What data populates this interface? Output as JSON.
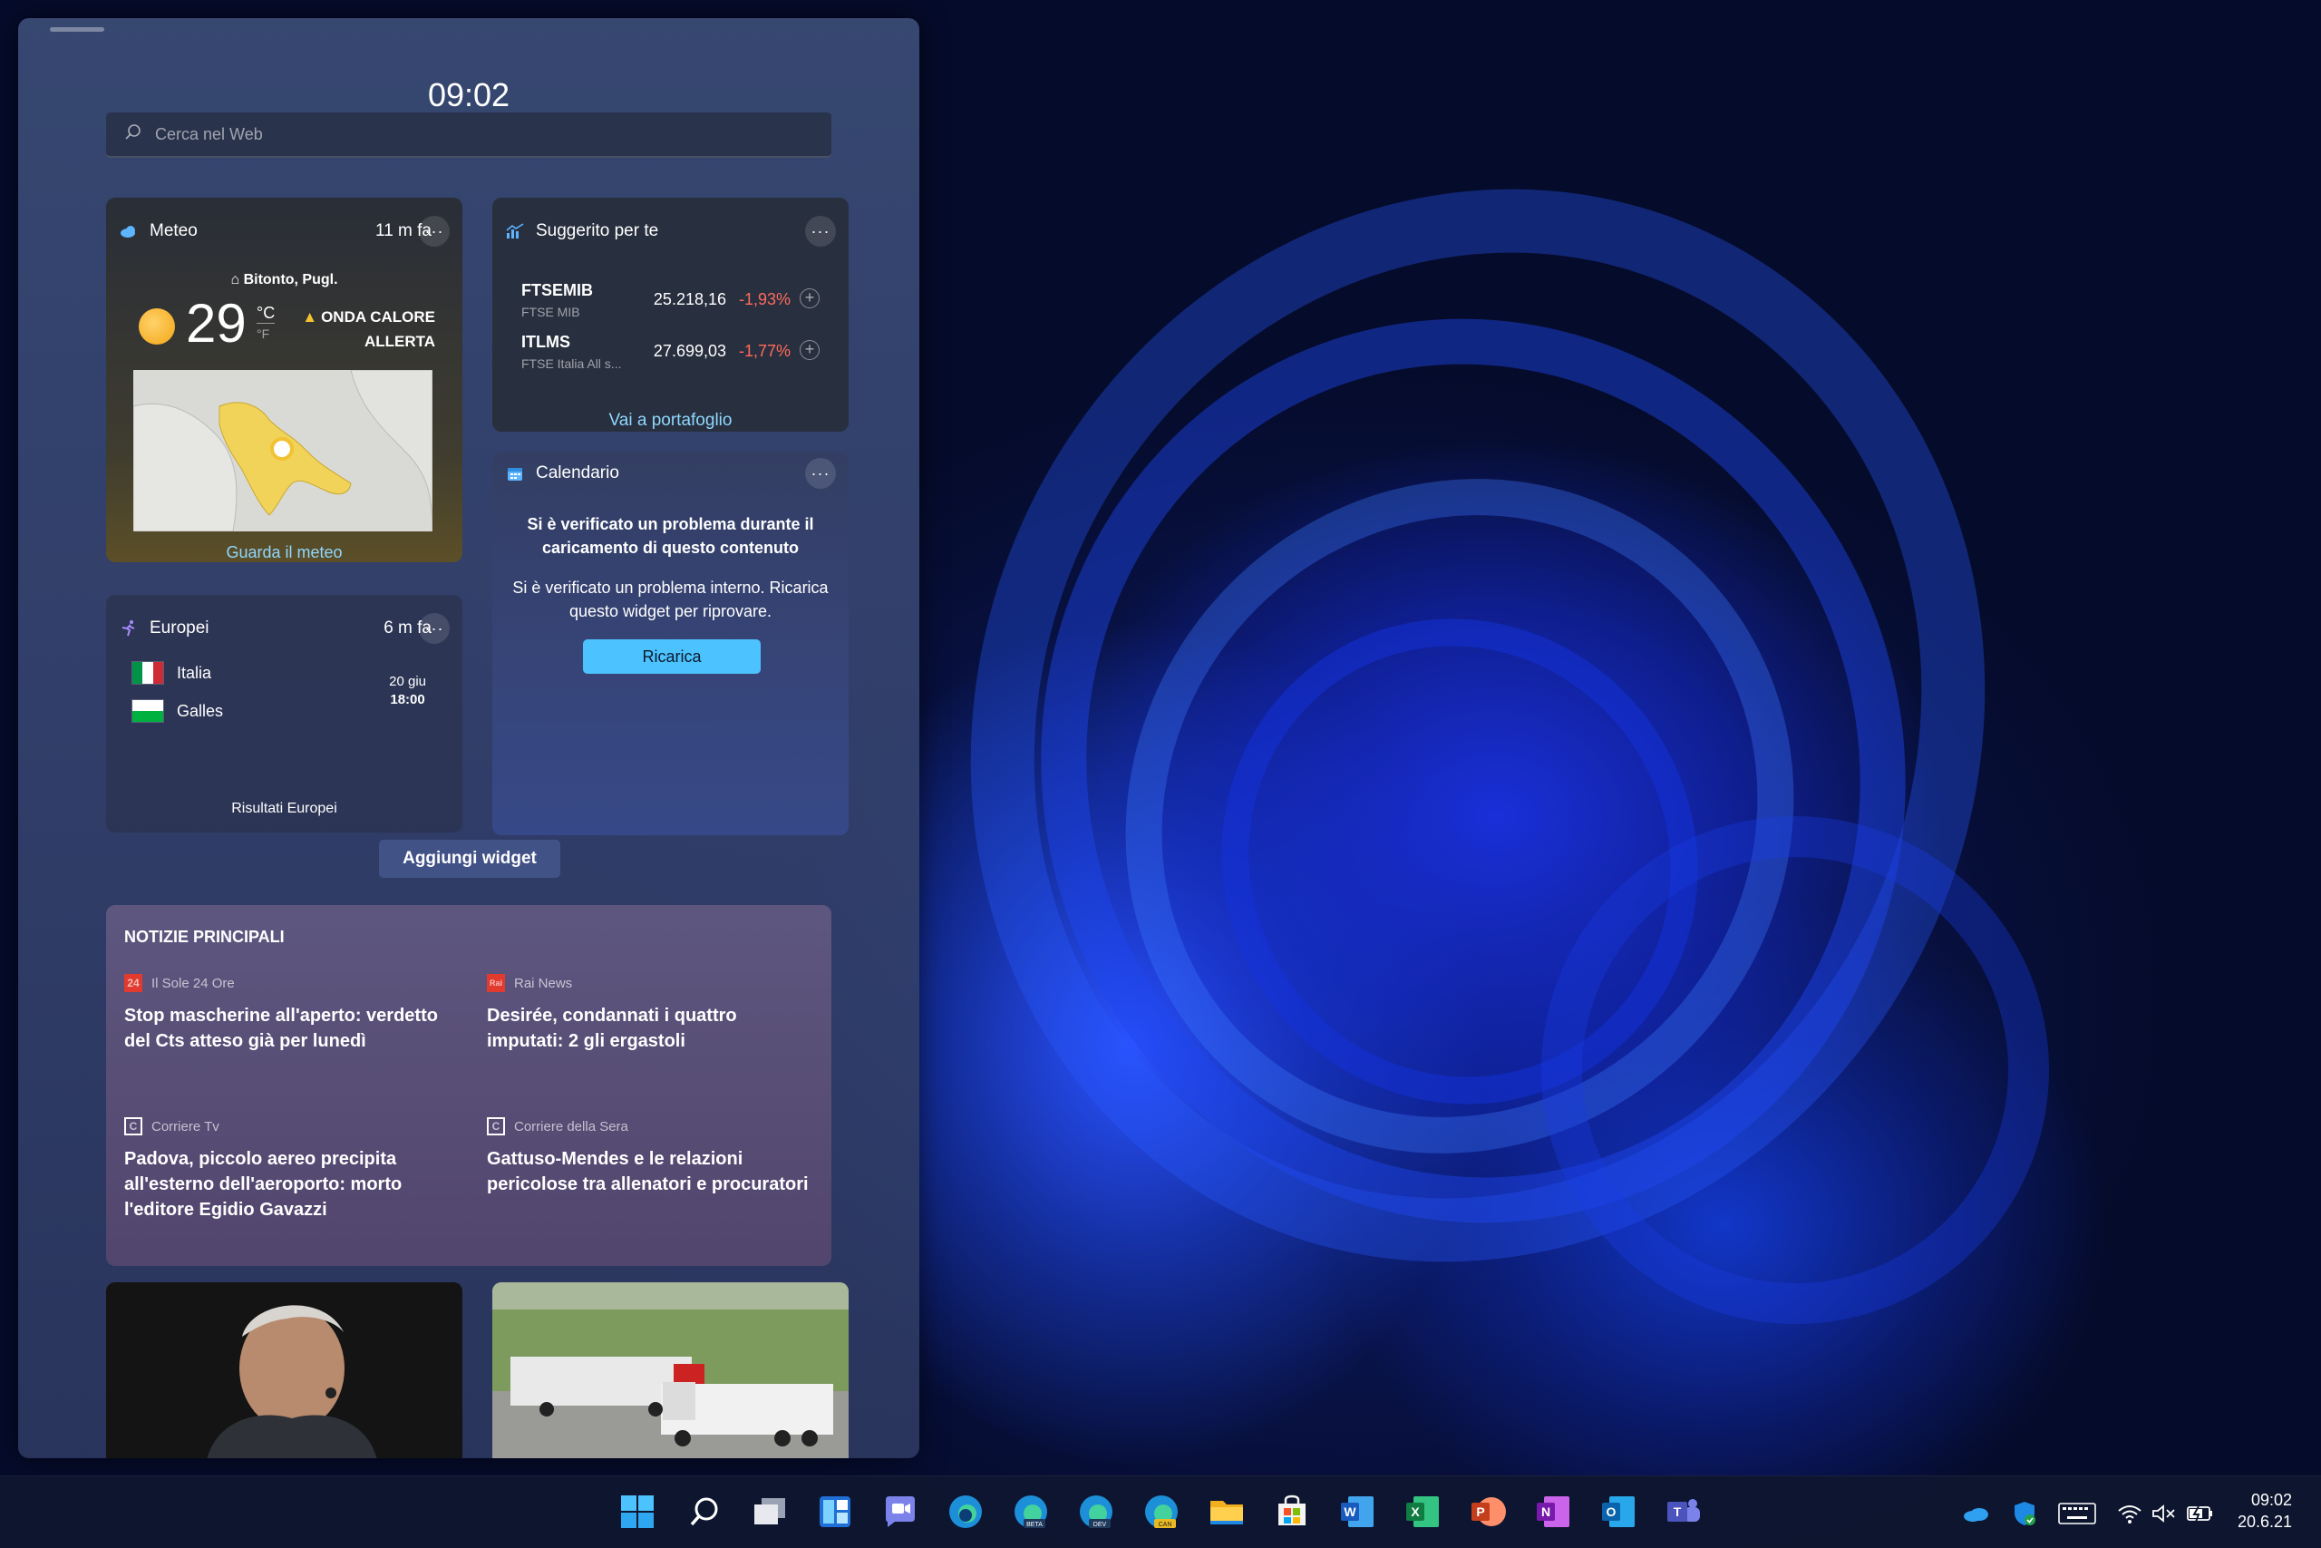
{
  "board": {
    "clock": "09:02",
    "search_placeholder": "Cerca nel Web"
  },
  "weather": {
    "title": "Meteo",
    "updated": "11 m fa",
    "more": "···",
    "location": "Bitonto, Pugl.",
    "temperature": "29",
    "unit_c": "°C",
    "unit_f": "°F",
    "alert_line1": "ONDA CALORE",
    "alert_line2": "ALLERTA",
    "link": "Guarda il meteo"
  },
  "stocks": {
    "title": "Suggerito per te",
    "more": "···",
    "rows": [
      {
        "symbol": "FTSEMIB",
        "name": "FTSE MIB",
        "value": "25.218,16",
        "change": "-1,93%"
      },
      {
        "symbol": "ITLMS",
        "name": "FTSE Italia All s...",
        "value": "27.699,03",
        "change": "-1,77%"
      }
    ],
    "link": "Vai a portafoglio"
  },
  "calendar": {
    "title": "Calendario",
    "more": "···",
    "error_title": "Si è verificato un problema durante il caricamento di questo contenuto",
    "error_body": "Si è verificato un problema interno. Ricarica questo widget per riprovare.",
    "button": "Ricarica"
  },
  "euro": {
    "title": "Europei",
    "updated": "6 m fa",
    "more": "···",
    "team1": "Italia",
    "team2": "Galles",
    "date": "20 giu",
    "time": "18:00",
    "link": "Risultati Europei"
  },
  "add_widget": "Aggiungi widget",
  "news": {
    "header": "NOTIZIE PRINCIPALI",
    "stories": [
      {
        "source": "Il Sole 24 Ore",
        "logo": "24",
        "title": "Stop mascherine all'aperto: verdetto del Cts atteso già per lunedì"
      },
      {
        "source": "Rai News",
        "logo": "Rai",
        "title": "Desirée, condannati i quattro imputati: 2 gli ergastoli"
      },
      {
        "source": "Corriere Tv",
        "logo": "C",
        "title": "Padova, piccolo aereo precipita all'esterno dell'aeroporto: morto l'editore Egidio Gavazzi"
      },
      {
        "source": "Corriere della Sera",
        "logo": "C",
        "title": "Gattuso-Mendes e le relazioni pericolose tra allenatori e procuratori"
      }
    ]
  },
  "taskbar": {
    "apps": [
      "start-icon",
      "search-icon",
      "task-view-icon",
      "widgets-icon",
      "chat-icon",
      "edge-icon",
      "edge-beta-icon",
      "edge-dev-icon",
      "edge-canary-icon",
      "file-explorer-icon",
      "store-icon",
      "word-icon",
      "excel-icon",
      "powerpoint-icon",
      "onenote-icon",
      "outlook-icon",
      "teams-icon"
    ],
    "time": "09:02",
    "date": "20.6.21"
  },
  "colors": {
    "accent": "#4cc2ff",
    "negative": "#ff6b5e",
    "alert": "#f3c330"
  }
}
